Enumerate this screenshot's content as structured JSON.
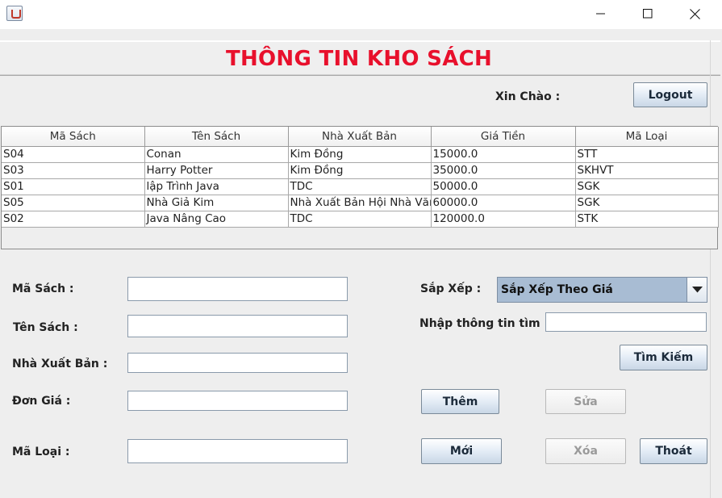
{
  "window": {
    "title": "",
    "app_icon": "java-cup-icon",
    "controls": [
      "minimize-icon",
      "maximize-icon",
      "close-icon"
    ]
  },
  "header": {
    "title": "THÔNG TIN KHO SÁCH",
    "title_color": "#e8102c"
  },
  "greeting": {
    "label": "Xin Chào :",
    "logout_label": "Logout"
  },
  "table": {
    "columns": [
      "Mã Sách",
      "Tên Sách",
      "Nhà Xuất Bản",
      "Giá Tiền",
      "Mã Loại"
    ],
    "rows": [
      [
        "S04",
        "Conan",
        "Kim Đồng",
        "15000.0",
        "STT"
      ],
      [
        "S03",
        "Harry Potter",
        "Kim Đồng",
        "35000.0",
        "SKHVT"
      ],
      [
        "S01",
        "lập Trình Java",
        "TDC",
        "50000.0",
        "SGK"
      ],
      [
        "S05",
        "Nhà Giả Kim",
        "Nhà Xuất Bản Hội Nhà Văn",
        "60000.0",
        "SGK"
      ],
      [
        "S02",
        "Java Nâng Cao",
        "TDC",
        "120000.0",
        "STK"
      ]
    ]
  },
  "form": {
    "ma_sach_label": "Mã Sách :",
    "ten_sach_label": "Tên Sách :",
    "nha_xuat_ban_label": "Nhà Xuất Bản :",
    "don_gia_label": "Đơn Giá :",
    "ma_loai_label": "Mã Loại :",
    "ma_sach_value": "",
    "ten_sach_value": "",
    "nha_xuat_ban_value": "",
    "don_gia_value": "",
    "ma_loai_value": ""
  },
  "sort": {
    "label": "Sắp Xếp :",
    "selected": "Sắp Xếp Theo Giá"
  },
  "search": {
    "label": "Nhập thông tin tìm :",
    "value": "",
    "button_label": "Tìm Kiếm"
  },
  "actions": {
    "them": "Thêm",
    "sua": "Sửa",
    "moi": "Mới",
    "xoa": "Xóa",
    "thoat": "Thoát"
  }
}
